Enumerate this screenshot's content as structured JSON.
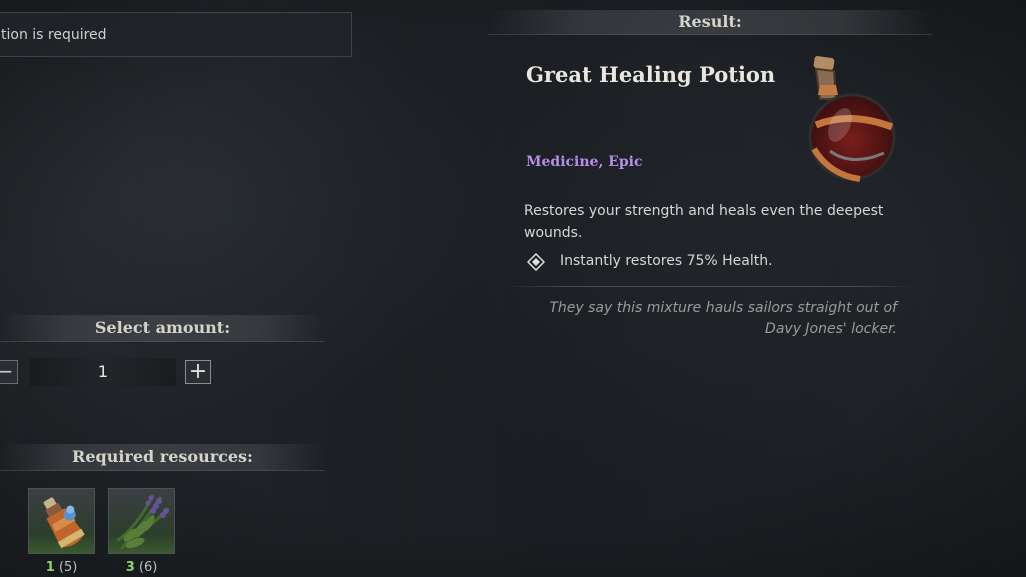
{
  "requirement": {
    "text": "tion is required"
  },
  "amount_section": {
    "header": "Select amount:",
    "value": "1",
    "minus_symbol": "−",
    "plus_symbol": "+"
  },
  "resources_section": {
    "header": "Required resources:",
    "items": [
      {
        "icon": "bottle-ingredient-icon",
        "have": "1",
        "need": "(5)"
      },
      {
        "icon": "lavender-herb-icon",
        "have": "3",
        "need": "(6)"
      }
    ]
  },
  "result": {
    "header": "Result:",
    "name": "Great Healing Potion",
    "category": "Medicine, Epic",
    "icon": "healing-potion-icon",
    "description": "Restores your strength and heals even the deepest wounds.",
    "effect_icon": "diamond-bullet-icon",
    "effect": "Instantly restores 75% Health.",
    "flavor": "They say this mixture hauls sailors straight out of Davy Jones' locker."
  },
  "colors": {
    "background": "#1d2024",
    "rarity_epic": "#b48ee8",
    "resource_have": "#8fd46a"
  }
}
